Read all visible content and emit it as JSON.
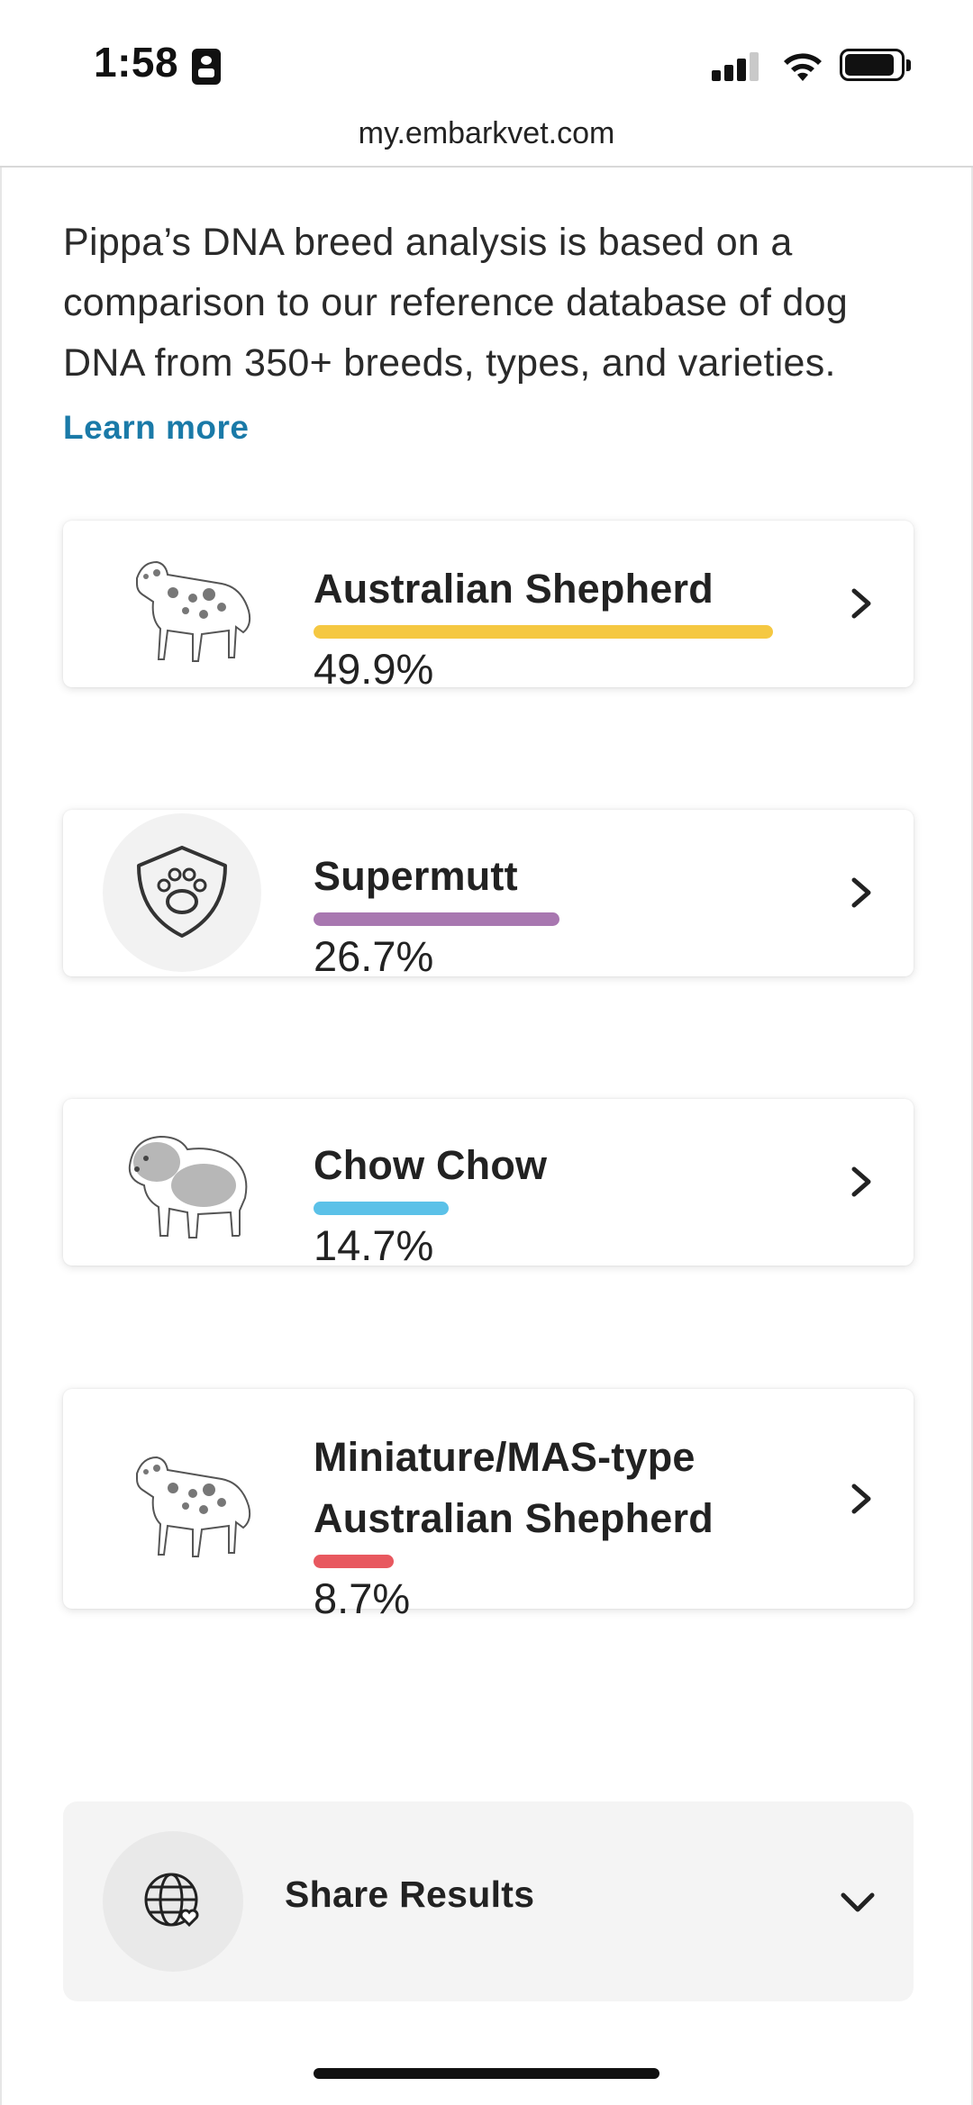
{
  "status_bar": {
    "time": "1:58"
  },
  "browser": {
    "url": "my.embarkvet.com"
  },
  "intro": {
    "text": "Pippa’s DNA breed analysis is based on a comparison to our reference database of dog DNA from 350+ breeds, types, and varieties.",
    "learn_more": "Learn more"
  },
  "breeds": [
    {
      "name": "Australian Shepherd",
      "percent_label": "49.9%",
      "percent": 49.9,
      "color": "#f5c842",
      "image": "australian-shepherd-illustration"
    },
    {
      "name": "Supermutt",
      "percent_label": "26.7%",
      "percent": 26.7,
      "color": "#a877b0",
      "image": "paw-shield-icon"
    },
    {
      "name": "Chow Chow",
      "percent_label": "14.7%",
      "percent": 14.7,
      "color": "#5bc1e8",
      "image": "chow-chow-illustration"
    },
    {
      "name": "Miniature/MAS-type Australian Shepherd",
      "name_line1": "Miniature/MAS-type",
      "name_line2": "Australian Shepherd",
      "percent_label": "8.7%",
      "percent": 8.7,
      "color": "#e8585f",
      "image": "australian-shepherd-illustration"
    }
  ],
  "share": {
    "label": "Share Results",
    "icon": "globe-heart-icon"
  }
}
